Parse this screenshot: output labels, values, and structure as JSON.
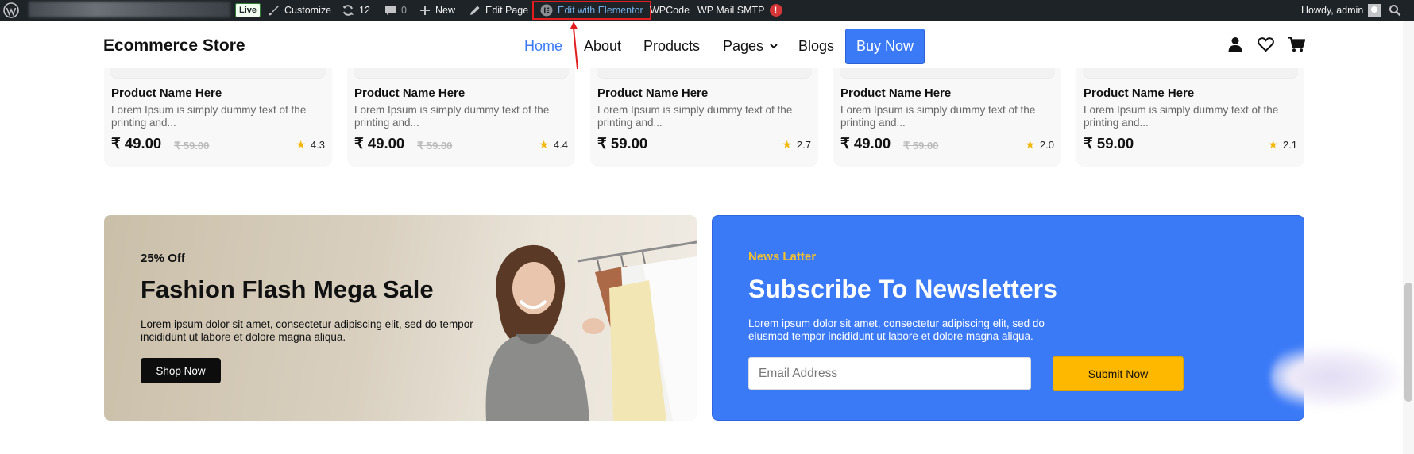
{
  "adminbar": {
    "live": "Live",
    "customize": "Customize",
    "updates": "12",
    "comments": "0",
    "new": "New",
    "edit_page": "Edit Page",
    "elementor": "Edit with Elementor",
    "wpcode": "WPCode",
    "smtp": "WP Mail SMTP",
    "smtp_badge": "!",
    "howdy": "Howdy, admin",
    "icons": [
      "wordpress-logo-icon",
      "paintbrush-icon",
      "refresh-icon",
      "comment-icon",
      "plus-icon",
      "pencil-icon",
      "elementor-icon",
      "avatar-icon",
      "search-icon"
    ]
  },
  "header": {
    "logo": "Ecommerce Store",
    "nav": {
      "home": "Home",
      "about": "About",
      "products": "Products",
      "pages": "Pages",
      "blogs": "Blogs"
    },
    "buy_now": "Buy Now",
    "icons": [
      "user-icon",
      "heart-icon",
      "cart-icon"
    ],
    "accent": "#3b7af7"
  },
  "products": [
    {
      "name": "Product Name Here",
      "desc": "Lorem Ipsum is simply dummy text of the printing and...",
      "price": "₹ 49.00",
      "old_price": "₹ 59.00",
      "rating": "4.3"
    },
    {
      "name": "Product Name Here",
      "desc": "Lorem Ipsum is simply dummy text of the printing and...",
      "price": "₹ 49.00",
      "old_price": "₹ 59.00",
      "rating": "4.4"
    },
    {
      "name": "Product Name Here",
      "desc": "Lorem Ipsum is simply dummy text of the printing and...",
      "price": "₹ 59.00",
      "old_price": "",
      "rating": "2.7"
    },
    {
      "name": "Product Name Here",
      "desc": "Lorem Ipsum is simply dummy text of the printing and...",
      "price": "₹ 49.00",
      "old_price": "₹ 59.00",
      "rating": "2.0"
    },
    {
      "name": "Product Name Here",
      "desc": "Lorem Ipsum is simply dummy text of the printing and...",
      "price": "₹ 59.00",
      "old_price": "",
      "rating": "2.1"
    }
  ],
  "promo": {
    "discount": "25% Off",
    "title": "Fashion Flash Mega Sale",
    "text": "Lorem ipsum dolor sit amet, consectetur adipiscing elit, sed do tempor incididunt ut labore et dolore magna aliqua.",
    "button": "Shop Now"
  },
  "newsletter": {
    "kicker": "News Latter",
    "title": "Subscribe To Newsletters",
    "text": "Lorem ipsum dolor sit amet, consectetur adipiscing elit, sed do eiusmod tempor incididunt ut labore et dolore magna aliqua.",
    "placeholder": "Email Address",
    "button": "Submit Now",
    "bg": "#3b7af7",
    "button_bg": "#ffb800"
  }
}
